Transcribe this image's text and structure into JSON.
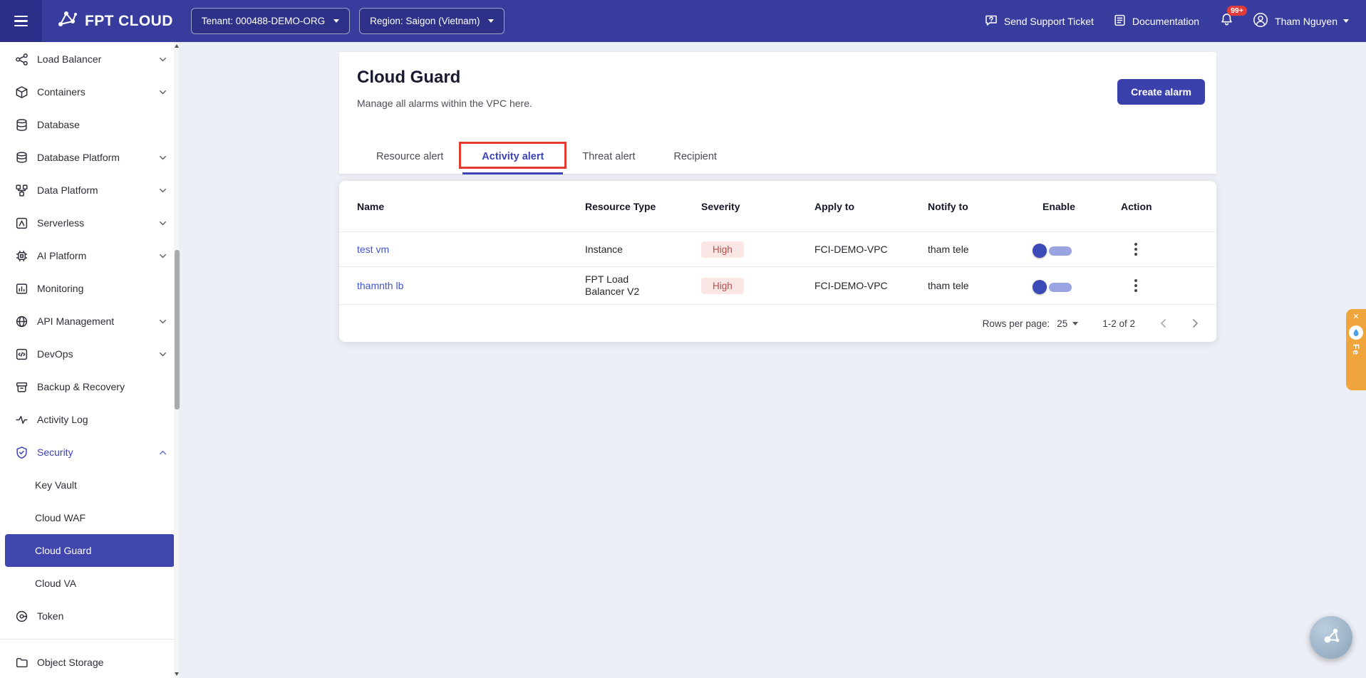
{
  "topbar": {
    "brand": "FPT CLOUD",
    "tenant_label": "Tenant: 000488-DEMO-ORG",
    "region_label": "Region: Saigon (Vietnam)",
    "support_label": "Send Support Ticket",
    "docs_label": "Documentation",
    "notification_badge": "99+",
    "user_name": "Tham Nguyen"
  },
  "sidebar": {
    "items": [
      {
        "label": "Load Balancer"
      },
      {
        "label": "Containers"
      },
      {
        "label": "Database"
      },
      {
        "label": "Database Platform"
      },
      {
        "label": "Data Platform"
      },
      {
        "label": "Serverless"
      },
      {
        "label": "AI Platform"
      },
      {
        "label": "Monitoring"
      },
      {
        "label": "API Management"
      },
      {
        "label": "DevOps"
      },
      {
        "label": "Backup & Recovery"
      },
      {
        "label": "Activity Log"
      },
      {
        "label": "Security"
      }
    ],
    "security_children": [
      {
        "label": "Key Vault"
      },
      {
        "label": "Cloud WAF"
      },
      {
        "label": "Cloud Guard"
      },
      {
        "label": "Cloud VA"
      }
    ],
    "bottom_items": [
      {
        "label": "Token"
      },
      {
        "label": "Object Storage"
      }
    ]
  },
  "page": {
    "title": "Cloud Guard",
    "subtitle": "Manage all alarms within the VPC here.",
    "create_button": "Create alarm",
    "tabs": [
      {
        "label": "Resource alert"
      },
      {
        "label": "Activity alert"
      },
      {
        "label": "Threat alert"
      },
      {
        "label": "Recipient"
      }
    ]
  },
  "table": {
    "columns": [
      "Name",
      "Resource Type",
      "Severity",
      "Apply to",
      "Notify to",
      "Enable",
      "Action"
    ],
    "rows": [
      {
        "name": "test vm",
        "resource_type": "Instance",
        "severity": "High",
        "apply_to": "FCI-DEMO-VPC",
        "notify_to": "tham tele",
        "enabled": true
      },
      {
        "name": "thamnth lb",
        "resource_type": "FPT Load Balancer V2",
        "severity": "High",
        "apply_to": "FCI-DEMO-VPC",
        "notify_to": "tham tele",
        "enabled": true
      }
    ],
    "footer": {
      "rows_per_page_label": "Rows per page:",
      "rows_per_page_value": "25",
      "range_label": "1-2 of 2"
    }
  },
  "widgets": {
    "feedback_label": "Fe",
    "close_glyph": "✕"
  },
  "colors": {
    "topbar": "#383d9d",
    "accent": "#3a41ad",
    "annotation_red": "#e53a2e",
    "severity_high_bg": "#f9e6e5",
    "severity_high_text": "#b4504c",
    "feedback_orange": "#f0a43c"
  }
}
